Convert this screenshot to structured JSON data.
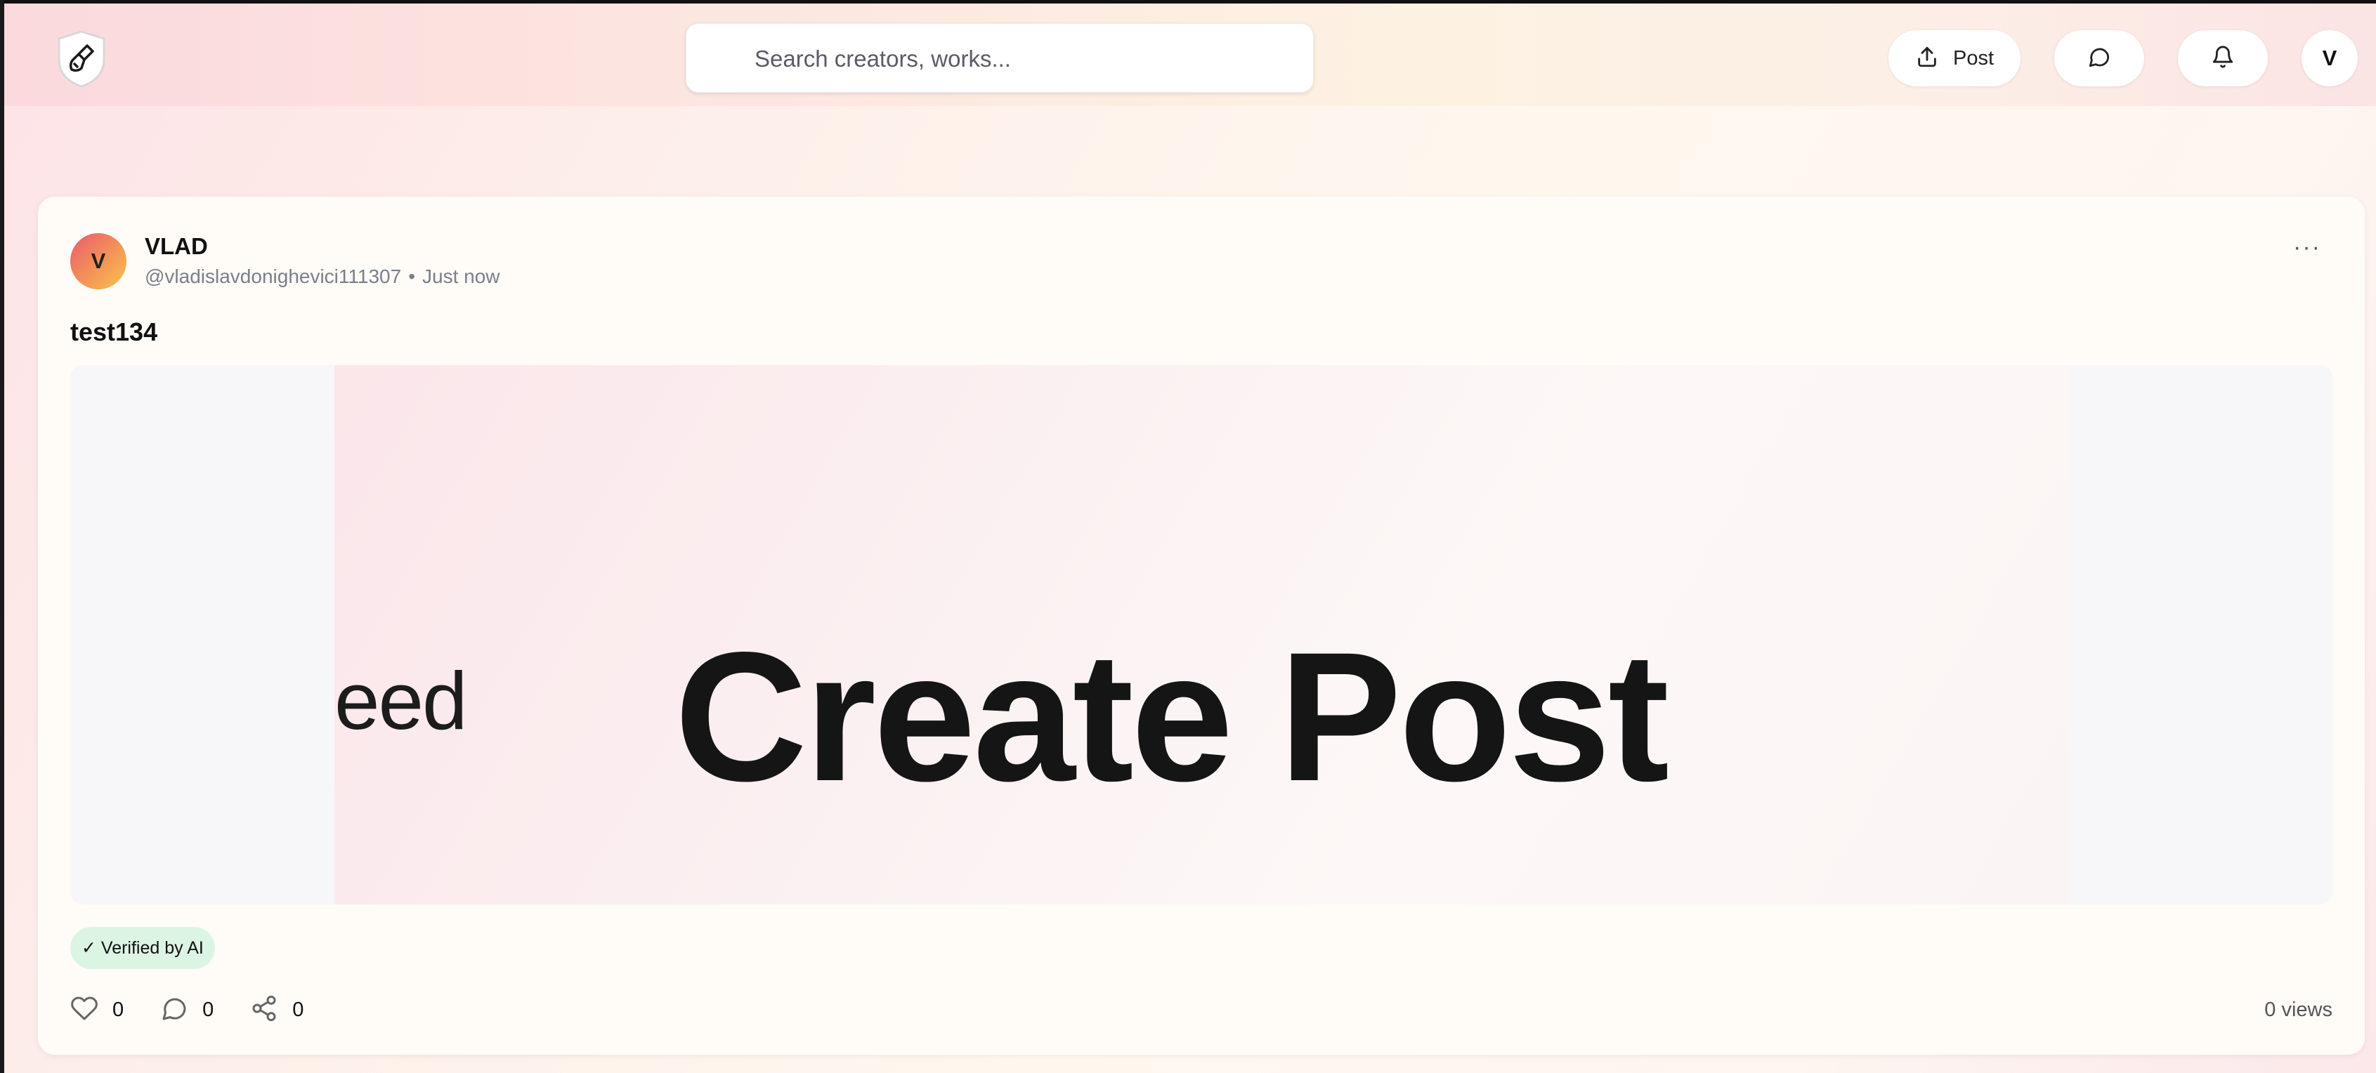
{
  "header": {
    "search_placeholder": "Search creators, works...",
    "post_label": "Post",
    "avatar_initial": "V"
  },
  "post": {
    "avatar_initial": "V",
    "author_name": "VLAD",
    "handle": "@vladislavdonighevici111307",
    "separator": "•",
    "time": "Just now",
    "more_label": "···",
    "title": "test134",
    "image": {
      "partial_text": "eed",
      "main_text": "Create Post"
    },
    "badge": "✓ Verified by AI",
    "likes": "0",
    "comments": "0",
    "shares": "0",
    "views": "0 views"
  },
  "colors": {
    "badge_bg": "#dcf5e3",
    "avatar_gradient_start": "#ea5a6f",
    "avatar_gradient_end": "#f9c44a"
  },
  "icons": [
    "brush-shield-logo-icon",
    "upload-icon",
    "chat-bubble-icon",
    "bell-icon",
    "heart-icon",
    "comment-icon",
    "share-icon",
    "more-icon"
  ]
}
